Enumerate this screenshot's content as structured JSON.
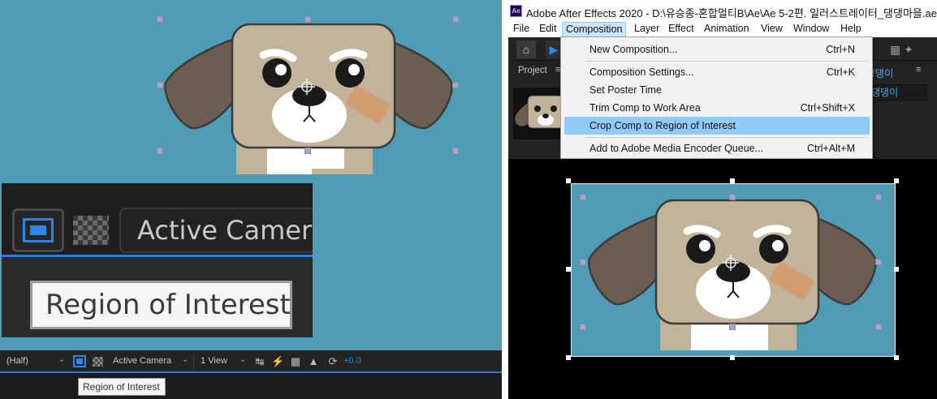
{
  "left_panel": {
    "zoom_view": {
      "active_camera_label": "Active Camera",
      "tooltip_label": "Region of Interest"
    },
    "viewer_toolbar": {
      "resolution_label": "(Half)",
      "camera_label": "Active Camera",
      "views_label": "1 View",
      "exposure_value": "+0.0"
    },
    "tooltip_label": "Region of Interest"
  },
  "right_panel": {
    "app_logo": "Ae",
    "window_title": "Adobe After Effects 2020 - D:\\유승종-혼합멀티B\\Ae\\Ae 5-2편. 일러스트레이터_댕댕마을.aep",
    "menu": [
      "File",
      "Edit",
      "Composition",
      "Layer",
      "Effect",
      "Animation",
      "View",
      "Window",
      "Help"
    ],
    "active_menu": "Composition",
    "project_tab_label": "Project",
    "comp_tab_label": "댕댕이",
    "comp_search_value": "댕댕이",
    "composition_menu": {
      "items": [
        {
          "label": "New Composition...",
          "shortcut": "Ctrl+N",
          "highlighted": false
        },
        {
          "label": "Composition Settings...",
          "shortcut": "Ctrl+K",
          "highlighted": false
        },
        {
          "label": "Set Poster Time",
          "shortcut": "",
          "highlighted": false
        },
        {
          "label": "Trim Comp to Work Area",
          "shortcut": "Ctrl+Shift+X",
          "highlighted": false
        },
        {
          "label": "Crop Comp to Region of Interest",
          "shortcut": "",
          "highlighted": true
        },
        {
          "label": "Add to Adobe Media Encoder Queue...",
          "shortcut": "Ctrl+Alt+M",
          "highlighted": false
        }
      ]
    }
  },
  "colors": {
    "comp_background": "#4f9cb4",
    "highlight": "#91c9f7",
    "accent_blue": "#2f84e6",
    "dog_face": "#c2b49b",
    "dog_ear": "#6b5d52",
    "dog_outline": "#3b3b3b"
  },
  "icons": [
    "home-icon",
    "selection-tool-icon",
    "region-of-interest-icon",
    "transparency-grid-icon",
    "dropdown-caret-icon",
    "hamburger-menu-icon"
  ]
}
